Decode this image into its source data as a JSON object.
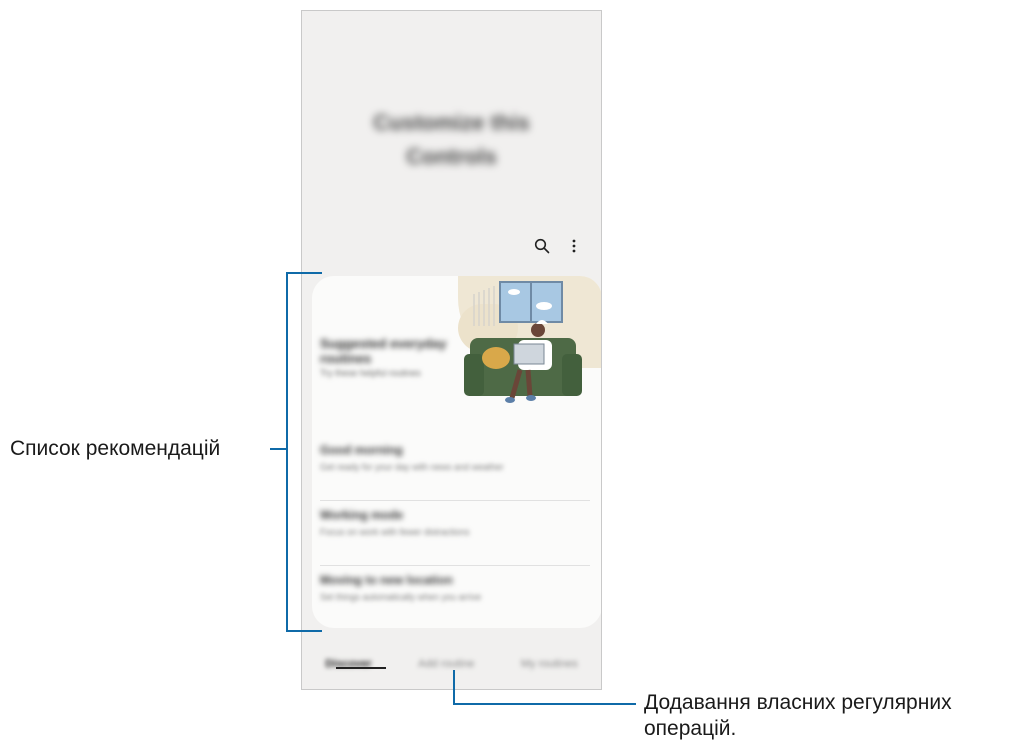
{
  "phone": {
    "header_title_lines": [
      "Customize this",
      "Controls"
    ],
    "hero": {
      "title": "Suggested everyday routines",
      "subtitle": "Try these helpful routines"
    },
    "recommendations": [
      {
        "title": "Good morning",
        "desc": "Get ready for your day with news and weather"
      },
      {
        "title": "Working mode",
        "desc": "Focus on work with fewer distractions"
      },
      {
        "title": "Moving to new location",
        "desc": "Set things automatically when you arrive"
      }
    ],
    "tabs": [
      {
        "label": "Discover",
        "active": true
      },
      {
        "label": "Add routine",
        "active": false
      },
      {
        "label": "My routines",
        "active": false
      }
    ],
    "icons": {
      "search": "search-icon",
      "more": "more-options-icon"
    }
  },
  "callouts": {
    "recommendations_label": "Список рекомендацій",
    "add_routine_label_line1": "Додавання власних регулярних",
    "add_routine_label_line2": "операцій."
  },
  "colors": {
    "callout_line": "#0f6aa8",
    "screen_bg": "#f1f0ef",
    "card_bg": "#fbfbfa"
  }
}
